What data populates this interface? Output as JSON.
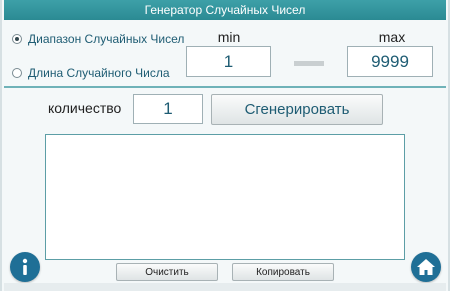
{
  "app": {
    "title": "Генератор Случайных Чисел"
  },
  "mode": {
    "options": [
      {
        "label": "Диапазон Случайных Чисел",
        "selected": true
      },
      {
        "label": "Длина Случайного Числа",
        "selected": false
      }
    ]
  },
  "range": {
    "min_label": "min",
    "max_label": "max",
    "min_value": "1",
    "max_value": "9999"
  },
  "count": {
    "label": "количество",
    "value": "1"
  },
  "actions": {
    "generate_label": "Сгенерировать",
    "clear_label": "Очистить",
    "copy_label": "Копировать"
  },
  "output": {
    "text": ""
  },
  "icons": {
    "info": "info-icon",
    "home": "home-icon"
  },
  "colors": {
    "accent": "#2b8a93",
    "icon_bg": "#1f6f96",
    "text": "#1e5c73"
  }
}
